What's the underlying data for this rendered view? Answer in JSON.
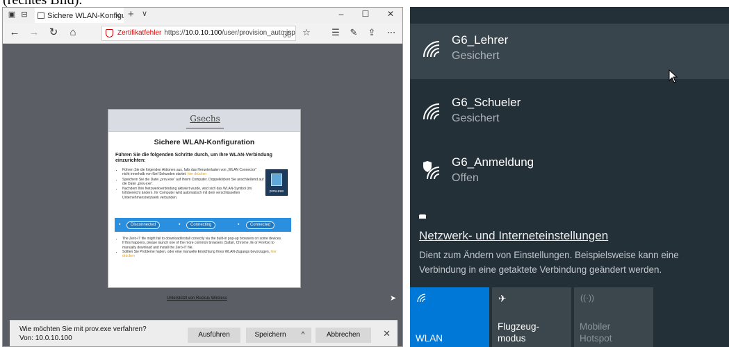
{
  "caption": "(rechtes Bild).",
  "browser": {
    "tab_title": "Sichere WLAN-Konfigur",
    "cert_error": "Zertifikatfehler",
    "url_prefix": "https://",
    "url_host": "10.0.10.100",
    "url_path": "/user/provision_auto.jsp",
    "portal": {
      "logo_text": "Gsechs",
      "title": "Sichere WLAN-Konfiguration",
      "subtitle": "Führen Sie die folgenden Schritte durch, um Ihre WLAN-Verbindung einzurichten:",
      "step1_text": "Führen Sie die folgenden Aktionen aus, falls das Herunterladen von „WLAN Connector“ nicht innerhalb von fünf Sekunden startet:",
      "step1_link": "hier drücken",
      "step2": "Speichern Sie die Datei „prov.exe“ auf Ihrem Computer. Doppelklicken Sie anschließend auf die Datei „prov.exe“.",
      "step3": "Nachdem Ihre Netzwerkverbindung aktiviert wurde, wird sich das WLAN-Symbol (im Infobereich) ändern. Ihr Computer wird automatisch mit dem verschlüsselten Unternehmensnetzwerk verbunden.",
      "prov_label": "prov.exe",
      "status_disconnected": "Disconnected",
      "status_connecting": "Connecting",
      "status_connected": "Connected",
      "note1": "The Zero-IT file might fail to download/install correctly via the built-in pop-up browsers on some devices. If this happens, please launch one of the more common browsers (Safari, Chrome, IE or Firefox) to manually download and install the Zero-IT file.",
      "note2_text": "Sollten Sie Probleme haben, oder eine manuelle Einrichtung Ihres WLAN-Zugangs bevorzugen,",
      "note2_link": "hier drücken",
      "footer": "Unterstützt von Ruckus Wireless"
    },
    "download": {
      "question": "Wie möchten Sie mit prov.exe verfahren?",
      "from": "Von: 10.0.10.100",
      "run": "Ausführen",
      "save": "Speichern",
      "cancel": "Abbrechen"
    }
  },
  "flyout": {
    "networks": [
      {
        "name": "G6_Lehrer",
        "status": "Gesichert"
      },
      {
        "name": "G6_Schueler",
        "status": "Gesichert"
      },
      {
        "name": "G6_Anmeldung",
        "status": "Offen"
      }
    ],
    "settings_link": "Netzwerk- und Interneteinstellungen",
    "settings_desc": "Dient zum Ändern von Einstellungen. Beispielsweise kann eine Verbindung in eine getaktete Verbindung geändert werden.",
    "tiles": {
      "wlan": "WLAN",
      "flight_1": "Flugzeug-",
      "flight_2": "modus",
      "hotspot_1": "Mobiler",
      "hotspot_2": "Hotspot"
    }
  },
  "colors": {
    "accent": "#0078d7",
    "flyout_bg": "#243038",
    "tile_inactive": "#3b464d",
    "cert_error": "#dd0000"
  }
}
